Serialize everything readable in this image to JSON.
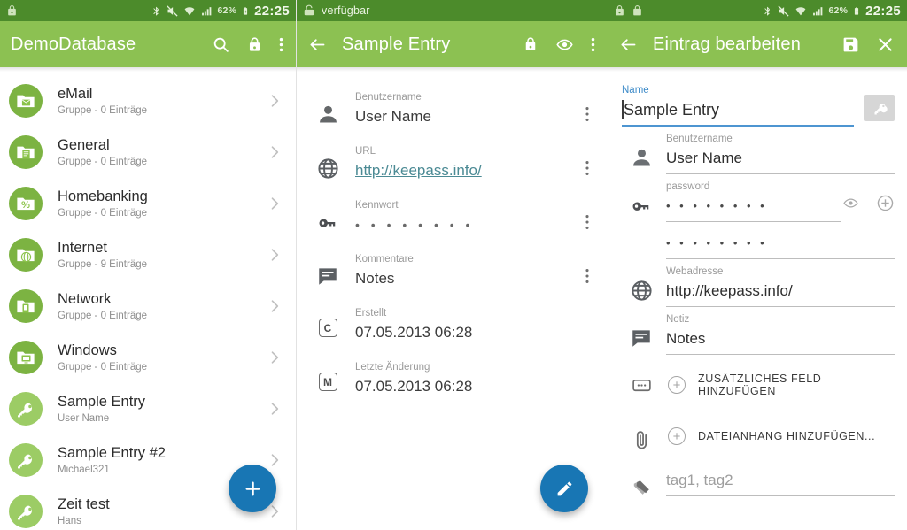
{
  "statusbar": {
    "time": "22:25",
    "battery_percent": "62%",
    "icons": [
      "lock-icon",
      "bluetooth-icon",
      "mute-icon",
      "wifi-icon",
      "signal-icon",
      "battery-charging-icon"
    ],
    "panel2_text": "verfügbar",
    "panel2_icon": "lock-open-icon",
    "panel3_icons": [
      "lock-icon",
      "lock-keyboard-icon"
    ]
  },
  "colors": {
    "status_green": "#4c8b2b",
    "appbar_green": "#8cc152",
    "group_avatar_green": "#7cb342",
    "entry_avatar_green": "#9ccc65",
    "fab_blue": "#1876b4",
    "link_teal": "#4b8a94",
    "focus_blue": "#4d95d1"
  },
  "database_screen": {
    "title": "DemoDatabase",
    "actions": [
      {
        "name": "search-icon",
        "label": "Suchen"
      },
      {
        "name": "lock-icon",
        "label": "Sperren"
      },
      {
        "name": "overflow-menu-icon",
        "label": "Mehr"
      }
    ],
    "fab": {
      "name": "add-fab",
      "label": "+"
    },
    "items": [
      {
        "title": "eMail",
        "subtitle": "Gruppe - 0 Einträge",
        "kind": "group"
      },
      {
        "title": "General",
        "subtitle": "Gruppe - 0 Einträge",
        "kind": "group"
      },
      {
        "title": "Homebanking",
        "subtitle": "Gruppe - 0 Einträge",
        "kind": "group"
      },
      {
        "title": "Internet",
        "subtitle": "Gruppe - 9 Einträge",
        "kind": "group"
      },
      {
        "title": "Network",
        "subtitle": "Gruppe - 0 Einträge",
        "kind": "group"
      },
      {
        "title": "Windows",
        "subtitle": "Gruppe - 0 Einträge",
        "kind": "group"
      },
      {
        "title": "Sample Entry",
        "subtitle": "User Name",
        "kind": "entry"
      },
      {
        "title": "Sample Entry #2",
        "subtitle": "Michael321",
        "kind": "entry"
      },
      {
        "title": "Zeit test",
        "subtitle": "Hans",
        "kind": "entry"
      }
    ]
  },
  "detail_screen": {
    "title": "Sample Entry",
    "back": "zurück",
    "actions": [
      {
        "name": "lock-icon",
        "label": "Sperren"
      },
      {
        "name": "eye-icon",
        "label": "Anzeigen"
      },
      {
        "name": "overflow-menu-icon",
        "label": "Mehr"
      }
    ],
    "fab": {
      "name": "edit-fab",
      "label": "Bearbeiten"
    },
    "fields": [
      {
        "icon": "person-icon",
        "label": "Benutzername",
        "value": "User Name",
        "type": "text"
      },
      {
        "icon": "globe-icon",
        "label": "URL",
        "value": "http://keepass.info/",
        "type": "link"
      },
      {
        "icon": "key-icon",
        "label": "Kennwort",
        "value": "• • • • • • • •",
        "type": "password"
      },
      {
        "icon": "notes-icon",
        "label": "Kommentare",
        "value": "Notes",
        "type": "text"
      },
      {
        "icon": "created-icon",
        "label": "Erstellt",
        "value": "07.05.2013 06:28",
        "type": "date",
        "glyph": "C"
      },
      {
        "icon": "modified-icon",
        "label": "Letzte Änderung",
        "value": "07.05.2013 06:28",
        "type": "date",
        "glyph": "M"
      }
    ]
  },
  "edit_screen": {
    "title": "Eintrag bearbeiten",
    "back": "zurück",
    "actions": [
      {
        "name": "save-icon",
        "label": "Speichern"
      },
      {
        "name": "close-icon",
        "label": "Abbrechen"
      }
    ],
    "name_field": {
      "label": "Name",
      "value": "Sample Entry"
    },
    "generate_button": {
      "name": "generate-password-button",
      "label": "Passwort erzeugen"
    },
    "fields": [
      {
        "icon": "person-icon",
        "label": "Benutzername",
        "value": "User Name"
      },
      {
        "icon": "globe-icon",
        "label": "Webadresse",
        "value": "http://keepass.info/"
      },
      {
        "icon": "notes-icon",
        "label": "Notiz",
        "value": "Notes"
      }
    ],
    "password": {
      "icon": "key-icon",
      "label": "password",
      "value": "• • • • • • • •",
      "confirm_value": "• • • • • • • •",
      "show_icon": "eye-icon",
      "generate_icon": "plus-circle-icon"
    },
    "add_field": {
      "icon": "extra-field-icon",
      "label": "ZUSÄTZLICHES FELD HINZUFÜGEN"
    },
    "add_attachment": {
      "icon": "paperclip-icon",
      "label": "DATEIANHANG HINZUFÜGEN..."
    },
    "tags": {
      "icon": "tag-icon",
      "placeholder": "tag1, tag2"
    }
  }
}
